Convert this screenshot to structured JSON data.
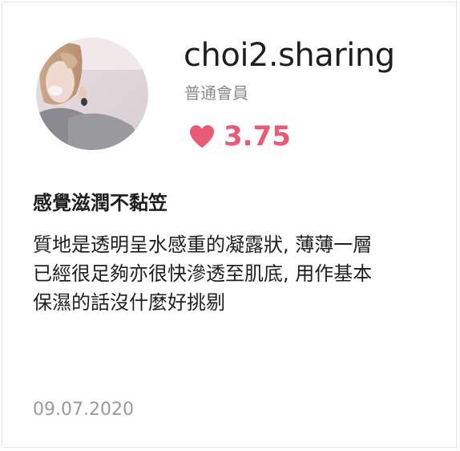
{
  "profile": {
    "username": "choi2.sharing",
    "role": "普通會員",
    "rating": "3.75"
  },
  "review": {
    "title": "感覺滋潤不黏笠",
    "body_lines": [
      "質地是透明呈水感重的凝露狀, 薄薄一層",
      "已經很足夠亦很快滲透至肌底, 用作基本",
      "保濕的話沒什麼好挑剔"
    ],
    "date": "09.07.2020"
  },
  "icons": {
    "rating": "heart-icon"
  },
  "colors": {
    "accent": "#e85a75",
    "text": "#1f1f1f",
    "muted": "#8a8a8a",
    "border": "#e6e6e6"
  }
}
